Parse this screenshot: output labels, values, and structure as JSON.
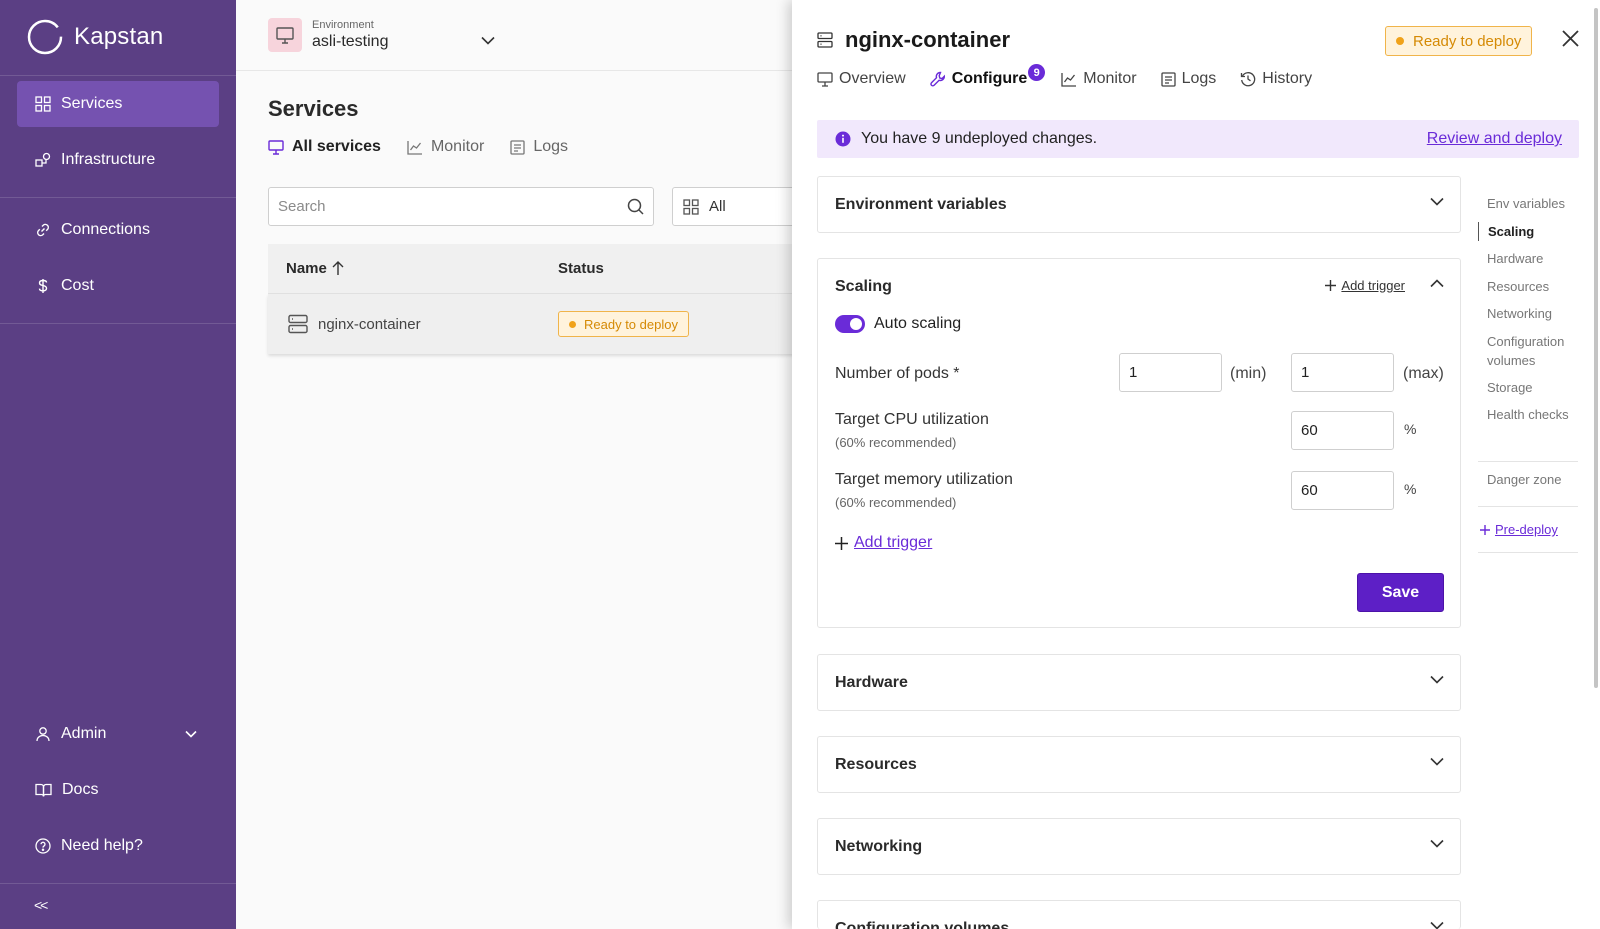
{
  "brand": {
    "name": "Kapstan"
  },
  "sidebar": {
    "items": [
      {
        "label": "Services",
        "icon": "grid-icon"
      },
      {
        "label": "Infrastructure",
        "icon": "infrastructure-icon"
      },
      {
        "label": "Connections",
        "icon": "link-icon"
      },
      {
        "label": "Cost",
        "icon": "dollar-icon"
      },
      {
        "label": "Admin",
        "icon": "user-icon"
      },
      {
        "label": "Docs",
        "icon": "book-icon"
      },
      {
        "label": "Need help?",
        "icon": "help-icon"
      }
    ],
    "collapse_label": "<<"
  },
  "environment": {
    "label": "Environment",
    "value": "asli-testing"
  },
  "services_page": {
    "title": "Services",
    "tabs": [
      "All services",
      "Monitor",
      "Logs"
    ],
    "search_placeholder": "Search",
    "filter_label": "All",
    "columns": [
      "Name",
      "Status"
    ],
    "rows": [
      {
        "name": "nginx-container",
        "status": "Ready to deploy"
      }
    ]
  },
  "panel": {
    "title": "nginx-container",
    "status": "Ready to deploy",
    "tabs": [
      "Overview",
      "Configure",
      "Monitor",
      "Logs",
      "History"
    ],
    "configure_count": "9",
    "banner": {
      "text": "You have 9 undeployed changes.",
      "link": "Review and deploy"
    },
    "sections": {
      "env": "Environment variables",
      "scaling": "Scaling",
      "hardware": "Hardware",
      "resources": "Resources",
      "networking": "Networking",
      "config_volumes": "Configuration volumes"
    },
    "scaling": {
      "add_trigger_top": "Add trigger",
      "auto_scaling": "Auto scaling",
      "pods_label": "Number of pods *",
      "pods_min": "1",
      "pods_min_unit": "(min)",
      "pods_max": "1",
      "pods_max_unit": "(max)",
      "cpu_label": "Target CPU utilization",
      "cpu_sub": "(60% recommended)",
      "cpu_value": "60",
      "memory_label": "Target memory utilization",
      "memory_sub": "(60% recommended)",
      "memory_value": "60",
      "percent": "%",
      "add_trigger": "Add trigger",
      "save": "Save"
    },
    "toc": [
      "Env variables",
      "Scaling",
      "Hardware",
      "Resources",
      "Networking",
      "Configuration volumes",
      "Storage",
      "Health checks",
      "Danger zone"
    ],
    "toc_predeploy": "Pre-deploy"
  },
  "colors": {
    "sidebar": "#5b3f84",
    "accent": "#6a2bd8",
    "warning": "#f0a21a"
  }
}
